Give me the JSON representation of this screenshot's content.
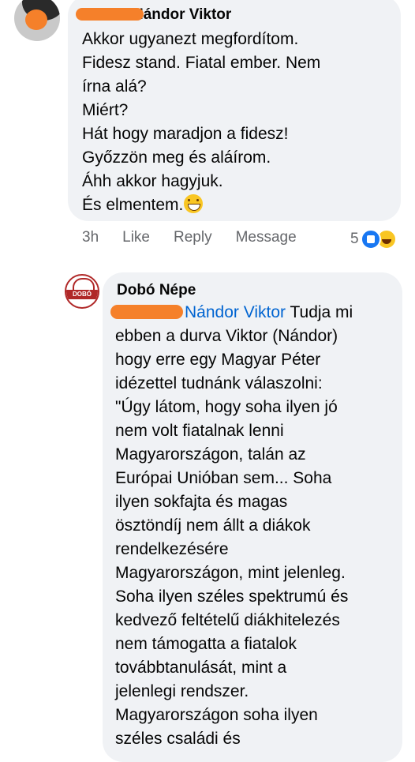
{
  "comment1": {
    "author": "Nándor Viktor",
    "lines": [
      "Akkor ugyanezt megfordítom.",
      "Fidesz stand. Fiatal ember. Nem",
      "írna alá?",
      "Miért?",
      "Hát hogy maradjon a fidesz!",
      "Győzzön meg és aláírom.",
      "Áhh akkor hagyjuk.",
      "És elmentem."
    ],
    "emoji_icon": "grinning-sweat-emoji",
    "actions": {
      "time": "3h",
      "like": "Like",
      "reply": "Reply",
      "message": "Message"
    },
    "reaction_count": "5",
    "reaction_icons": [
      "like-icon",
      "laughing-icon"
    ]
  },
  "comment2": {
    "author": "Dobó Népe",
    "avatar_text": "DOBÓ NÉPE",
    "mention": "Nándor Viktor",
    "first_line_rest": " Tudja mi",
    "lines": [
      "ebben a durva Viktor (Nándor)",
      "hogy erre egy Magyar Péter",
      "idézettel tudnánk válaszolni:",
      "\"Úgy látom, hogy soha ilyen jó",
      "nem volt fiatalnak lenni",
      "Magyarországon, talán az",
      "Európai Unióban sem... Soha",
      "ilyen sokfajta és magas",
      "ösztöndíj nem állt a diákok",
      "rendelkezésére",
      "Magyarországon, mint jelenleg.",
      "Soha ilyen széles spektrumú és",
      "kedvező feltételű diákhitelezés",
      "nem támogatta a fiatalok",
      "továbbtanulását, mint a",
      "jelenlegi rendszer.",
      "Magyarországon soha ilyen",
      "széles családi és"
    ]
  }
}
